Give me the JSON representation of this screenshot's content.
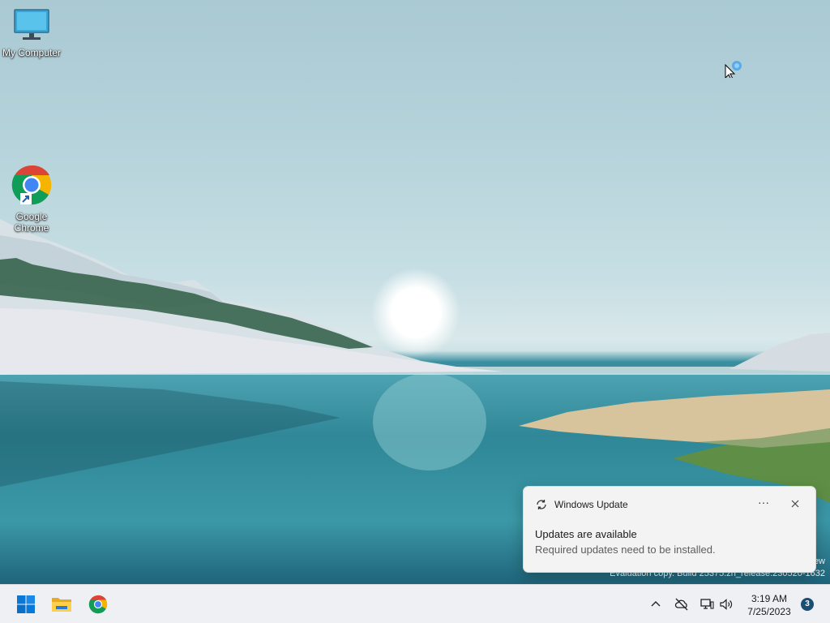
{
  "desktop": {
    "icons": [
      {
        "label": "My Computer",
        "icon": "monitor-icon"
      },
      {
        "label": "Google Chrome",
        "icon": "chrome-icon"
      }
    ],
    "watermark": {
      "line1": "ew",
      "line2": "Evaluation copy. Build 25375.zn_release.230520-1632"
    }
  },
  "notification": {
    "app": "Windows Update",
    "app_icon": "sync-icon",
    "more_label": "···",
    "title": "Updates are available",
    "body": "Required updates need to be installed."
  },
  "taskbar": {
    "pinned": [
      {
        "name": "Start",
        "icon": "windows-start-icon"
      },
      {
        "name": "File Explorer",
        "icon": "folder-icon"
      },
      {
        "name": "Google Chrome",
        "icon": "chrome-icon"
      }
    ],
    "tray": {
      "time": "3:19 AM",
      "date": "7/25/2023",
      "notification_count": "3"
    }
  },
  "colors": {
    "accent": "#0078d4",
    "badge": "#1b4f72"
  }
}
